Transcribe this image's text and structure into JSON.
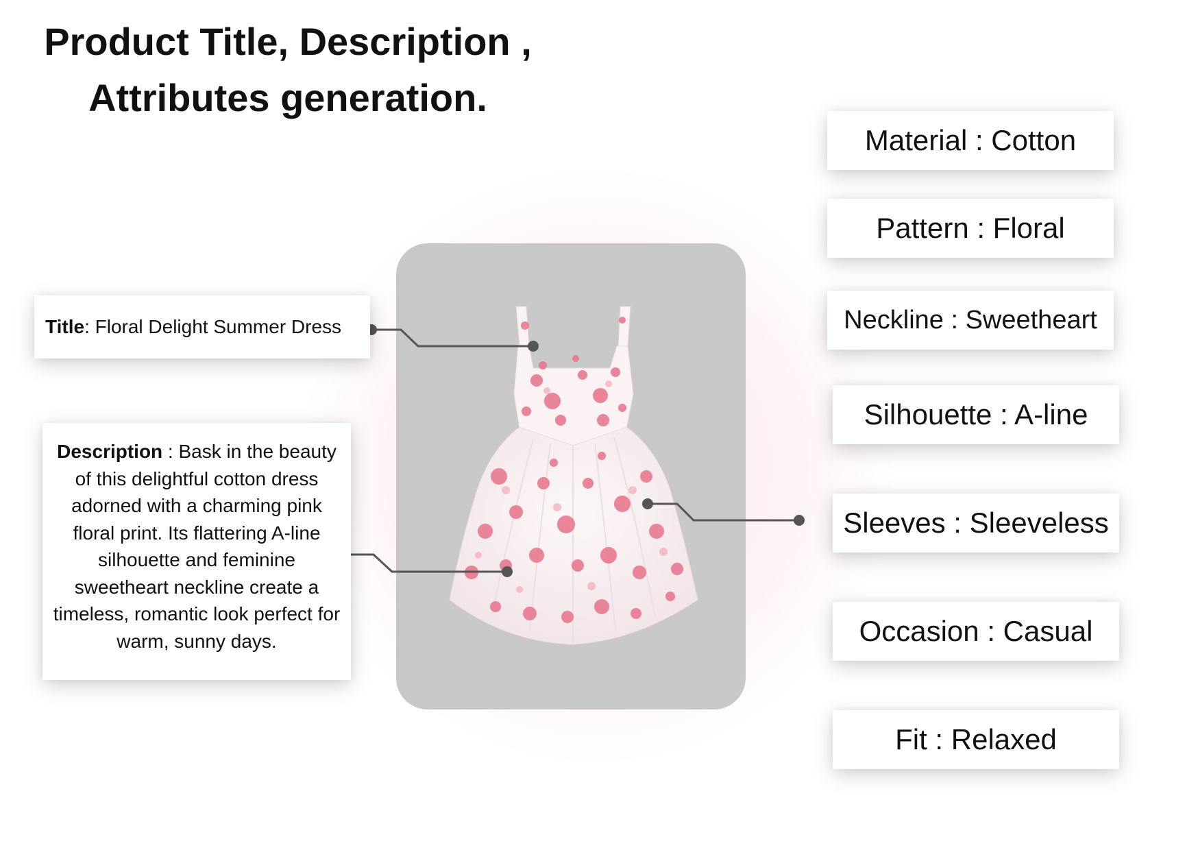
{
  "heading": {
    "line1": "Product Title, Description ,",
    "line2": "Attributes generation."
  },
  "title_box": {
    "label": "Title",
    "value": ": Floral Delight Summer Dress"
  },
  "description_box": {
    "label": "Description",
    "value": " : Bask in the beauty of this delightful cotton dress adorned with a charming pink floral print. Its flattering A-line silhouette and feminine sweetheart neckline create a timeless, romantic look perfect for warm, sunny days."
  },
  "attributes": {
    "material": "Material : Cotton",
    "pattern": "Pattern : Floral",
    "neckline": "Neckline : Sweetheart",
    "silhouette": "Silhouette : A-line",
    "sleeves": "Sleeves : Sleeveless",
    "occasion": "Occasion : Casual",
    "fit": "Fit : Relaxed"
  },
  "colors": {
    "card_background": "#c9c8c8",
    "dress_base": "#fbf3f3",
    "floral_print": "#e8728a",
    "connector": "#555555"
  }
}
